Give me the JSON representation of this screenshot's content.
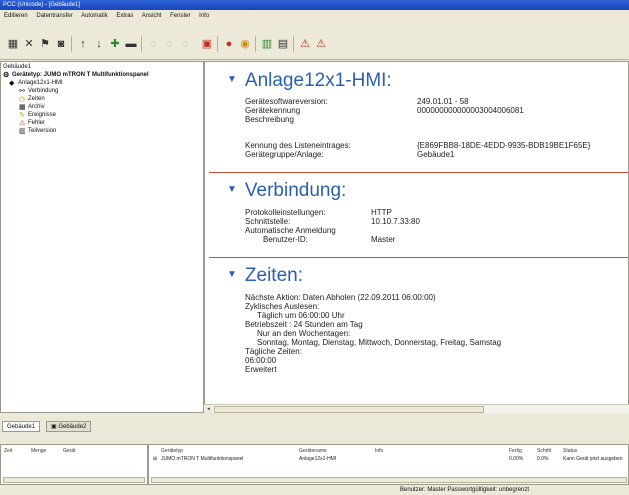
{
  "window": {
    "title": "PCC (Unicode) - [Gebäude1]"
  },
  "menu": [
    "Editieren",
    "Datentransfer",
    "Automatik",
    "Extras",
    "Ansicht",
    "Fenster",
    "Info"
  ],
  "tree": {
    "root": "Gebäude1",
    "device": "Gerätetyp: JUMO mTRON T Multifunktionspanel",
    "plant": "Anlage12x1-HMI",
    "children": [
      "Verbindung",
      "Zeiten",
      "Archiv",
      "Ereignisse",
      "Fehler",
      "Teilversion"
    ]
  },
  "anlage": {
    "title": "Anlage12x1-HMI:",
    "fw_label": "Gerätesoftwareversion:",
    "fw_value": "249.01.01 - 58",
    "id_label": "Gerätekennung",
    "id_value": "000000000000003004006081",
    "desc_label": "Beschreibung",
    "key_label": "Kennung des Listeneintrages:",
    "key_value": "{E869FBB8-18DE-4EDD-9935-BDB19BE1F65E}",
    "group_label": "Gerätegruppe/Anlage:",
    "group_value": "Gebäude1"
  },
  "verbindung": {
    "title": "Verbindung:",
    "proto_label": "Protokolleinstellungen:",
    "proto_value": "HTTP",
    "iface_label": "Schnittstelle:",
    "iface_value": "10.10.7.33:80",
    "auto_label": "Automatische Anmeldung",
    "user_label": "Benutzer-ID:",
    "user_value": "Master"
  },
  "zeiten": {
    "title": "Zeiten:",
    "lines": [
      "Nächste Aktion:  Daten Abholen (22.09.2011 06:00:00)",
      "Zyklisches Auslesen:",
      "Täglich um 06:00:00 Uhr",
      "Betriebszeit : 24 Stunden am Tag",
      "Nur an den Wochentagen:",
      "Sonntag, Montag, Dienstag, Mittwoch, Donnerstag, Freitag, Samstag",
      "Tägliche Zeiten:",
      "06:00:00",
      "Erweitert"
    ]
  },
  "tabs": [
    "Gebäude1",
    "Gebäude2"
  ],
  "log": {
    "left_cols": [
      "Zeit",
      "Menge",
      "Gerät"
    ],
    "right_cols": [
      "Gerätetyp",
      "Gerätename",
      "Info",
      "Fertig",
      "Schritt",
      "Status"
    ],
    "row": {
      "type": "JUMO mTRON T Multifunktionspanel",
      "name": "Anlage12x1-HMI",
      "info": "",
      "done": "0.00%",
      "step": "0.0%",
      "status": "Kann Gerät jetzt ausgeben"
    }
  },
  "status": "Benutzer: Master   Passwortgültigkeit: unbegrenzt",
  "colors": {
    "section_title": "#2a5fb0",
    "rule": "#d24a34",
    "titlebar": "#1b45b6"
  }
}
